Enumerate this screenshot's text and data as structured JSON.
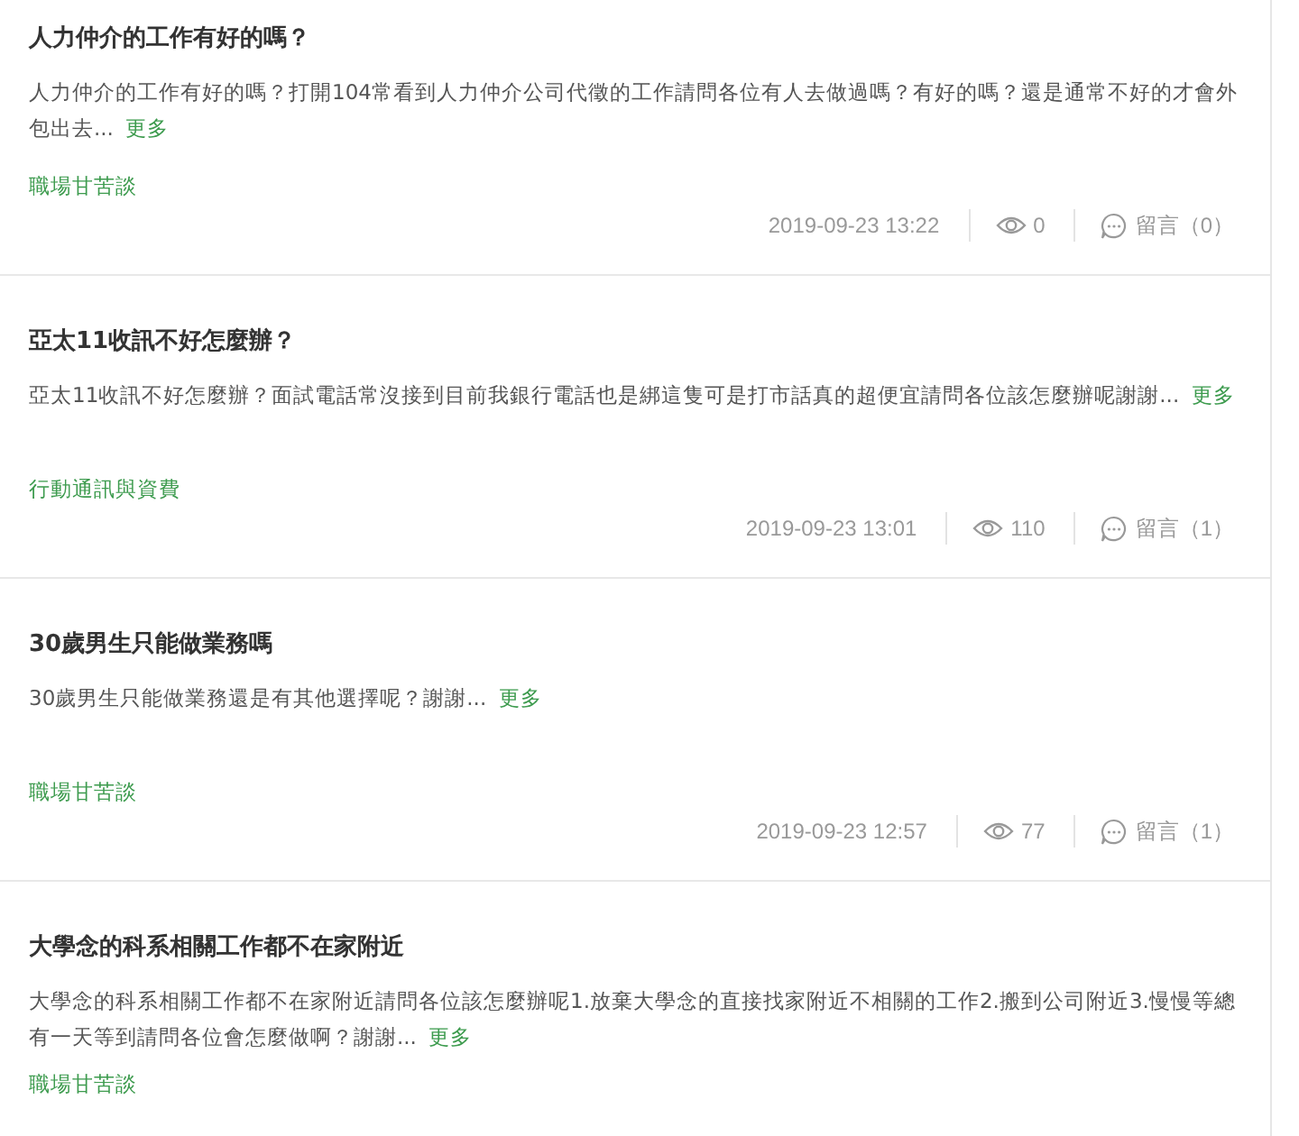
{
  "posts": [
    {
      "title": "人力仲介的工作有好的嗎？",
      "excerpt": "人力仲介的工作有好的嗎？打開104常看到人力仲介公司代徵的工作請問各位有人去做過嗎？有好的嗎？還是通常不好的才會外包出去...",
      "more": "更多",
      "category": "職場甘苦談",
      "date": "2019-09-23 13:22",
      "views": "0",
      "comments": "留言（0）"
    },
    {
      "title": "亞太11收訊不好怎麼辦？",
      "excerpt": "亞太11收訊不好怎麼辦？面試電話常沒接到目前我銀行電話也是綁這隻可是打市話真的超便宜請問各位該怎麼辦呢謝謝...",
      "more": "更多",
      "category": "行動通訊與資費",
      "date": "2019-09-23 13:01",
      "views": "110",
      "comments": "留言（1）"
    },
    {
      "title": "30歲男生只能做業務嗎",
      "excerpt": "30歲男生只能做業務還是有其他選擇呢？謝謝...",
      "more": "更多",
      "category": "職場甘苦談",
      "date": "2019-09-23 12:57",
      "views": "77",
      "comments": "留言（1）"
    },
    {
      "title": "大學念的科系相關工作都不在家附近",
      "excerpt": "大學念的科系相關工作都不在家附近請問各位該怎麼辦呢1.放棄大學念的直接找家附近不相關的工作2.搬到公司附近3.慢慢等總有一天等到請問各位會怎麼做啊？謝謝...",
      "more": "更多",
      "category": "職場甘苦談"
    }
  ]
}
